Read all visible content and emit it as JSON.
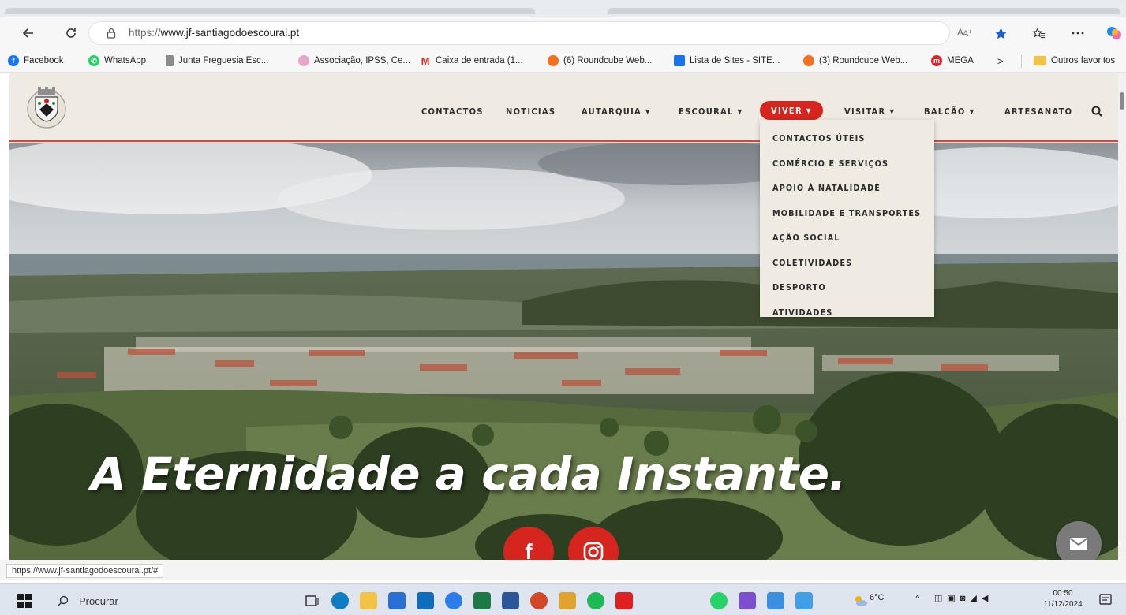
{
  "browser": {
    "url_scheme": "https://",
    "url_host": "www.jf-santiagodoescoural.pt",
    "status_url": "https://www.jf-santiagodoescoural.pt/#"
  },
  "bookmarks": [
    {
      "label": "Facebook",
      "icon": "facebook-icon",
      "color": "#1877f2"
    },
    {
      "label": "WhatsApp",
      "icon": "whatsapp-icon",
      "color": "#25d366"
    },
    {
      "label": "Junta Freguesia Esc...",
      "icon": "crest-icon",
      "color": "#8b8b8b"
    },
    {
      "label": "Associação, IPSS, Ce...",
      "icon": "flower-icon",
      "color": "#d35aa0"
    },
    {
      "label": "Caixa de entrada (1...",
      "icon": "gmail-icon",
      "color": "#d93025"
    },
    {
      "label": "(6) Roundcube Web...",
      "icon": "roundcube-icon",
      "color": "#f36f21"
    },
    {
      "label": "Lista de Sites - SITE...",
      "icon": "list-icon",
      "color": "#1a73e8"
    },
    {
      "label": "(3) Roundcube Web...",
      "icon": "roundcube-icon",
      "color": "#f36f21"
    },
    {
      "label": "MEGA",
      "icon": "mega-icon",
      "color": "#d9272e"
    }
  ],
  "bookmarks_more": ">",
  "other_favorites": "Outros favoritos",
  "nav": {
    "contactos": "CONTACTOS",
    "noticias": "NOTICIAS",
    "autarquia": "AUTARQUIA",
    "escoural": "ESCOURAL",
    "viver": "VIVER",
    "visitar": "VISITAR",
    "balcao": "BALCÃO",
    "artesanato": "ARTESANATO"
  },
  "viver_dropdown": [
    "CONTACTOS ÚTEIS",
    "COMÉRCIO E SERVIÇOS",
    "APOIO À NATALIDADE",
    "MOBILIDADE E TRANSPORTES",
    "AÇÃO SOCIAL",
    "COLETIVIDADES",
    "DESPORTO",
    "ATIVIDADES"
  ],
  "hero": {
    "tagline": "A Eternidade a cada Instante.",
    "facebook_glyph": "f"
  },
  "taskbar": {
    "search_placeholder": "Procurar",
    "weather": "6°C",
    "time": "00:50",
    "date": "11/12/2024"
  },
  "colors": {
    "accent": "#d6241e",
    "header_bg": "#efebe2"
  }
}
